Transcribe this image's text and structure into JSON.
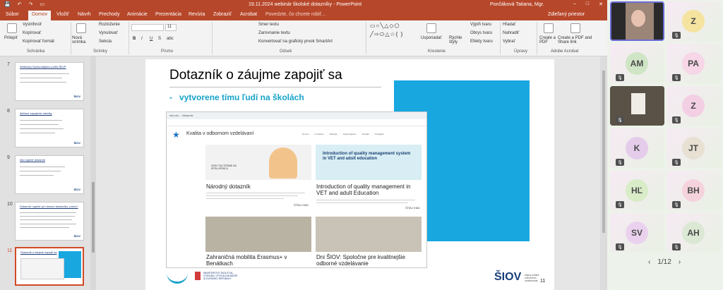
{
  "window": {
    "title": "19.11.2024 webinár školské dotazníky - PowerPoint",
    "user": "Pončáková Tatiana, Mgr.",
    "autosave_icon": "save-icon"
  },
  "tabs": [
    {
      "label": "Súbor"
    },
    {
      "label": "Domov"
    },
    {
      "label": "Vložiť"
    },
    {
      "label": "Návrh"
    },
    {
      "label": "Prechody"
    },
    {
      "label": "Animácie"
    },
    {
      "label": "Prezentácia"
    },
    {
      "label": "Revízia"
    },
    {
      "label": "Zobraziť"
    },
    {
      "label": "Acrobat"
    }
  ],
  "tell_me": "Povedzte, čo chcete robiť...",
  "share_label": "Zdieľaný priestor",
  "ribbon": {
    "clipboard": {
      "paste": "Prilepiť",
      "cut": "Vystrihnúť",
      "copy": "Kopírovať",
      "format": "Kopírovať formát",
      "label": "Schránka"
    },
    "slides": {
      "new": "Nová snímka",
      "layout": "Rozloženie",
      "reset": "Vynulovať",
      "section": "Sekcia",
      "label": "Snímky"
    },
    "font": {
      "size": "11",
      "bold": "B",
      "italic": "I",
      "underline": "U",
      "strike": "S",
      "shadow": "abc",
      "label": "Písmo"
    },
    "paragraph": {
      "direction": "Smer textu",
      "align": "Zarovnanie textu",
      "smartart": "Konvertovať na grafický prvok SmartArt",
      "label": "Odsek"
    },
    "drawing": {
      "arrange": "Usporiadať",
      "quick": "Rýchle štýly",
      "fill": "Výplň tvaru",
      "outline": "Obrys tvaru",
      "effects": "Efekty tvaru",
      "label": "Kreslenie"
    },
    "editing": {
      "find": "Hľadať",
      "replace": "Nahradiť",
      "select": "Vybrať",
      "label": "Úpravy"
    },
    "acrobat": {
      "create": "Create a PDF",
      "share": "Create a PDF and Share link",
      "label": "Adobe Acrobat"
    }
  },
  "thumbnails": [
    {
      "num": "7",
      "title": "Webináry Spravodajstvo podľa ŠkVP"
    },
    {
      "num": "8",
      "title": "Aktívne zapojenie stredky"
    },
    {
      "num": "9",
      "title": "Ako vyplniť dotazník"
    },
    {
      "num": "10",
      "title": "Dotazník: vyplniť pri rôznom dotazníku, prečo?"
    },
    {
      "num": "11",
      "title": "Dotazník o záujme zapojiť sa"
    }
  ],
  "slide": {
    "title": "Dotazník o záujme zapojiť sa",
    "bullet": "vytvorene tímu ľudí na školách",
    "number": "11",
    "logo": "ŠIOV",
    "logo_sub": "štátny inštitút odborného vzdelávania",
    "ministry": "MINISTERSTVO ŠKOLSTVA, VÝSKUMU, VÝVOJA A MLÁDEŽE SLOVENSKEJ REPUBLIKY",
    "browser": {
      "url": "siov.sk/..../dotaznik",
      "site": "Kvalita v odbornom vzdelávaní",
      "nav": [
        "Domov",
        "O stránke",
        "Nástroje",
        "Spravodajstvo",
        "Kontakt",
        "Podujatia"
      ],
      "cards": [
        {
          "title": "Národný dotazník",
          "cta": "ČÍTAJ VIAC",
          "banner": "VEDCI SA TEŠIME NA SPOLUPRÁCU"
        },
        {
          "title": "Introduction of quality management in VET and adult Education",
          "cta": "ČÍTAJ VIAC",
          "banner": "Introduction of quality management system in VET and adult education"
        },
        {
          "title": "Zahraničná mobilita Erasmus+ v Benátkach"
        },
        {
          "title": "Dni ŠIOV: Spoločne pre kvalitnejšie odborné vzdelávanie"
        }
      ]
    }
  },
  "participants": [
    {
      "initials": "",
      "video": true,
      "muted": false
    },
    {
      "initials": "Z",
      "muted": true
    },
    {
      "initials": "AM",
      "muted": true
    },
    {
      "initials": "PA",
      "muted": true
    },
    {
      "initials": "",
      "video": true,
      "muted": true
    },
    {
      "initials": "Z",
      "muted": true
    },
    {
      "initials": "K",
      "muted": true
    },
    {
      "initials": "JT",
      "muted": true
    },
    {
      "initials": "HĽ",
      "muted": true
    },
    {
      "initials": "BH",
      "muted": true
    },
    {
      "initials": "SV",
      "muted": true
    },
    {
      "initials": "AH",
      "muted": true
    }
  ],
  "pager": "1/12",
  "colors": {
    "ppt": "#b7472a",
    "slide_accent": "#19a7e0",
    "bullet": "#17a3c9"
  }
}
